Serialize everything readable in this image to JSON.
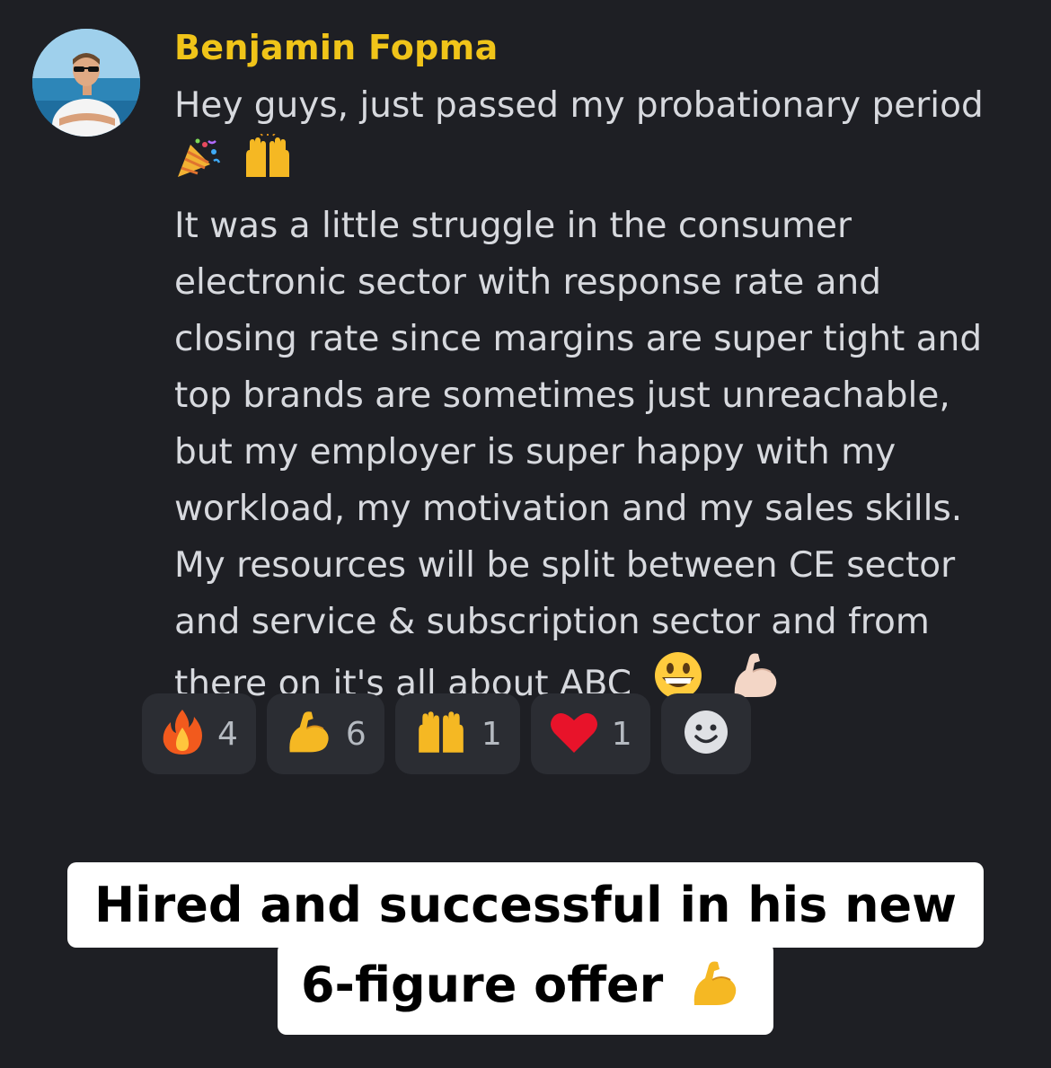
{
  "message": {
    "author": "Benjamin Fopma",
    "avatar_icon": "user-avatar-photo",
    "username_color": "#f0c419",
    "lines": [
      "Hey guys, just passed my probationary period",
      "",
      "It was a little struggle in the consumer",
      "electronic sector with response rate and",
      "closing rate since margins are super tight and",
      "top brands are sometimes just unreachable,",
      "but my employer is super happy with my",
      "workload, my motivation and my sales skills.",
      "My resources will be split between CE sector",
      "and service & subscription sector and from",
      "there on it's all about ABC"
    ],
    "inline_emojis_line2": [
      "party-popper-icon",
      "raising-hands-icon"
    ],
    "inline_emojis_end": [
      "grinning-face-icon",
      "flexed-biceps-icon"
    ]
  },
  "reactions": [
    {
      "emoji": "fire-icon",
      "count": "4"
    },
    {
      "emoji": "flexed-biceps-icon",
      "count": "6"
    },
    {
      "emoji": "raising-hands-icon",
      "count": "1"
    },
    {
      "emoji": "red-heart-icon",
      "count": "1"
    }
  ],
  "add_reaction_icon": "add-reaction-smiley-icon",
  "caption": {
    "line1": "Hired and successful in his new",
    "line2": "6-figure offer",
    "line2_emoji": "flexed-biceps-icon"
  },
  "colors": {
    "background": "#1e1f24",
    "reaction_bg": "#2b2d33",
    "text": "#d7d9de"
  }
}
